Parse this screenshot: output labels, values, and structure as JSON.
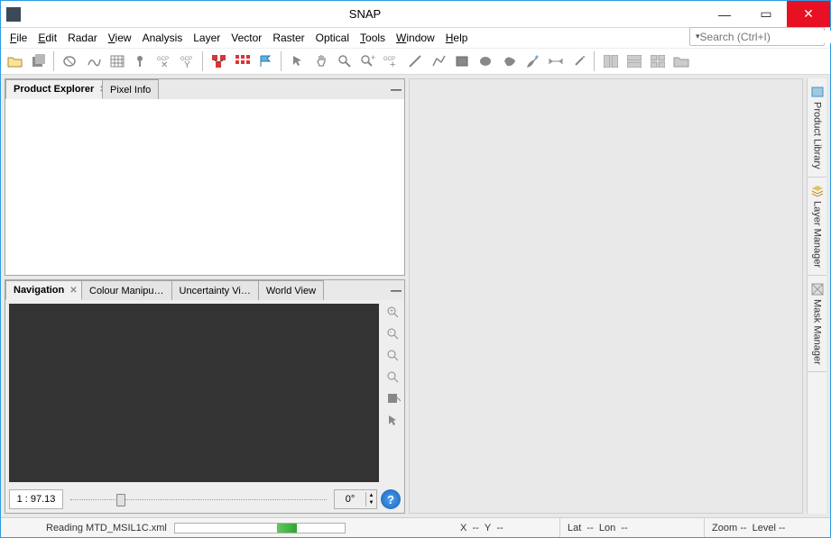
{
  "window": {
    "title": "SNAP"
  },
  "menu": [
    "File",
    "Edit",
    "Radar",
    "View",
    "Analysis",
    "Layer",
    "Vector",
    "Raster",
    "Optical",
    "Tools",
    "Window",
    "Help"
  ],
  "search": {
    "placeholder": "Search (Ctrl+I)"
  },
  "explorer": {
    "tabs": [
      {
        "label": "Product Explorer",
        "active": true,
        "closable": true
      },
      {
        "label": "Pixel Info",
        "active": false,
        "closable": false
      }
    ]
  },
  "navpanel": {
    "tabs": [
      {
        "label": "Navigation",
        "active": true,
        "closable": true
      },
      {
        "label": "Colour Manipu…",
        "active": false
      },
      {
        "label": "Uncertainty Vi…",
        "active": false
      },
      {
        "label": "World View",
        "active": false
      }
    ],
    "zoom_ratio": "1 : 97.13",
    "rotation": "0°"
  },
  "right_tabs": [
    "Product Library",
    "Layer Manager",
    "Mask Manager"
  ],
  "status": {
    "task": "Reading MTD_MSIL1C.xml",
    "x": "X",
    "xval": "--",
    "y": "Y",
    "yval": "--",
    "lat": "Lat",
    "latval": "--",
    "lon": "Lon",
    "lonval": "--",
    "zoom": "Zoom",
    "zoomval": "--",
    "level": "Level",
    "levelval": "--"
  },
  "colors": {
    "titlebar_close": "#e81123",
    "accent": "#2e9be6"
  }
}
